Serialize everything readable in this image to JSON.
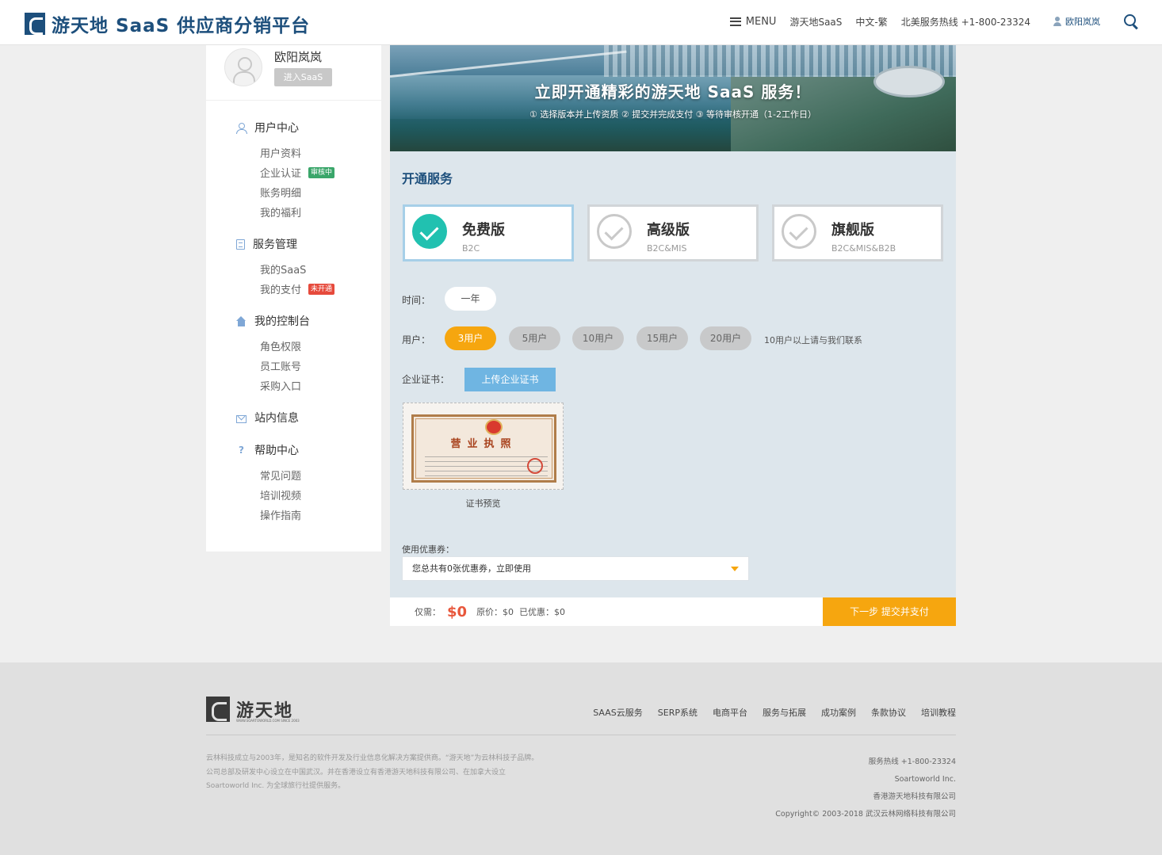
{
  "header": {
    "logo_text": "游天地 SaaS 供应商分销平台",
    "menu_label": "MENU",
    "nav_saas": "游天地SaaS",
    "nav_lang": "中文-繁",
    "nav_hotline": "北美服务热线 +1-800-23324",
    "nav_user": "欧阳岚岚"
  },
  "sidebar": {
    "profile_name": "欧阳岚岚",
    "saas_button": "进入SaaS",
    "groups": [
      {
        "title": "用户中心",
        "icon": "user-icon",
        "items": [
          "用户资料",
          "企业认证",
          "账务明细",
          "我的福利"
        ],
        "badge": "审核中"
      },
      {
        "title": "服务管理",
        "icon": "document-icon",
        "items": [
          "我的SaaS",
          "我的支付"
        ],
        "badge": "未开通"
      },
      {
        "title": "我的控制台",
        "icon": "home-icon",
        "items": [
          "角色权限",
          "员工账号",
          "采购入口"
        ]
      },
      {
        "title": "站内信息",
        "icon": "mail-icon",
        "items": []
      },
      {
        "title": "帮助中心",
        "icon": "help-icon",
        "items": [
          "常见问题",
          "培训视频",
          "操作指南"
        ]
      }
    ]
  },
  "banner": {
    "title": "立即开通精彩的游天地 SaaS 服务！",
    "steps": "① 选择版本并上传资质 ② 提交并完成支付 ③ 等待审核开通（1-2工作日）"
  },
  "service": {
    "section_title": "开通服务",
    "plans": [
      {
        "name": "免费版",
        "desc": "B2C",
        "selected": true
      },
      {
        "name": "高级版",
        "desc": "B2C&MIS",
        "selected": false
      },
      {
        "name": "旗舰版",
        "desc": "B2C&MIS&B2B",
        "selected": false
      }
    ],
    "time_label": "时间：",
    "time_value": "一年",
    "users_label": "用户：",
    "user_options": [
      "3用户",
      "5用户",
      "10用户",
      "15用户",
      "20用户"
    ],
    "users_note": "10用户以上请与我们联系",
    "cert_label": "企业证书：",
    "upload_button": "上传企业证书",
    "cert_title": "营业执照",
    "cert_caption": "证书预览",
    "coupon_label": "使用优惠券：",
    "coupon_value": "您总共有0张优惠券，立即使用"
  },
  "payment": {
    "only_label": "仅需：",
    "price": "$0",
    "original": "原价：$0",
    "discount": "已优惠：$0",
    "next_button": "下一步 提交并支付"
  },
  "footer": {
    "logo_text": "游天地",
    "logo_sub": "WWW.SOARTOWORLD.COM SINCE 2003",
    "links": [
      "SAAS云服务",
      "SERP系统",
      "电商平台",
      "服务与拓展",
      "成功案例",
      "条款协议",
      "培训教程"
    ],
    "about_1": "云林科技成立与2003年，是知名的软件开发及行业信息化解决方案提供商。“游天地”为云林科技子品牌。",
    "about_2": "公司总部及研发中心设立在中国武汉。并在香港设立有香港游天地科技有限公司、在加拿大设立",
    "about_3": "Soartoworld Inc. 为全球旅行社提供服务。",
    "hotline": "服务热线 +1-800-23324",
    "company_1": "Soartoworld Inc.",
    "company_2": "香港游天地科技有限公司",
    "copyright": "Copyright© 2003-2018 武汉云林网络科技有限公司"
  },
  "colors": {
    "brand": "#1d4f7c",
    "accent": "#f6a60f",
    "success": "#21c1b0",
    "price": "#e8573c"
  }
}
